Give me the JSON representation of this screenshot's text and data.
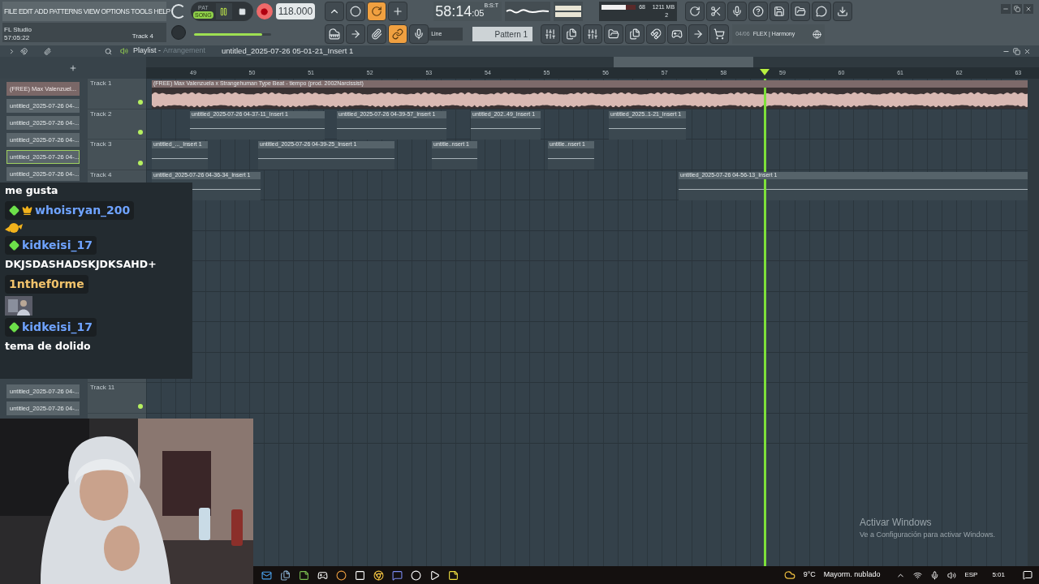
{
  "menu": [
    "FILE",
    "EDIT",
    "ADD",
    "PATTERNS",
    "VIEW",
    "OPTIONS",
    "TOOLS",
    "HELP"
  ],
  "hint_panel": {
    "title": "FL Studio",
    "time": "57:05:22",
    "track": "Track 4"
  },
  "transport": {
    "modes": [
      {
        "label": "PAT",
        "selected": false
      },
      {
        "label": "SONG",
        "selected": true
      }
    ],
    "playing": true,
    "recording": true,
    "tempo": "118.000"
  },
  "clock": {
    "time": "58:14",
    "sub": ":05",
    "unit": "B:S:T"
  },
  "cpu": {
    "level": 0.72,
    "polyphony": "68",
    "memory": "1211 MB",
    "count": "2"
  },
  "master_volume": {
    "level": 0.88
  },
  "snap": {
    "value": "Line"
  },
  "pattern": {
    "value": "Pattern 1"
  },
  "news": {
    "page": "04/06",
    "text": "FLEX | Harmony"
  },
  "playlist": {
    "title": "Playlist -",
    "subtitle": "Arrangement",
    "source": "untitled_2025-07-26 05-01-21_Insert 1",
    "bars": [
      "49",
      "50",
      "51",
      "52",
      "53",
      "54",
      "55",
      "56",
      "57",
      "58",
      "59",
      "60",
      "61",
      "62",
      "63"
    ]
  },
  "picker": {
    "top": [
      {
        "label": "(FREE) Max Valenzuel...",
        "kind": "audio",
        "selected": false
      },
      {
        "label": "untitled_2025-07-26 04-...",
        "kind": "pattern",
        "selected": false
      },
      {
        "label": "untitled_2025-07-26 04-...",
        "kind": "pattern",
        "selected": false
      },
      {
        "label": "untitled_2025-07-26 04-...",
        "kind": "pattern",
        "selected": false
      },
      {
        "label": "untitled_2025-07-26 04-...",
        "kind": "pattern",
        "selected": true
      },
      {
        "label": "untitled_2025-07-26 04-...",
        "kind": "pattern",
        "selected": false
      }
    ],
    "bottom": [
      {
        "label": "untitled_2025-07-26 04-...",
        "selected": false
      },
      {
        "label": "untitled_2025-07-26 04-...",
        "selected": false
      }
    ]
  },
  "tracks": [
    {
      "name": "Track 1",
      "on": true,
      "clips": [
        {
          "label": "(FREE) Max Valenzuela x Strangehuman Type Beat - tiempo (prod. 2002Narcissist)",
          "kind": "audio"
        }
      ]
    },
    {
      "name": "Track 2",
      "on": true,
      "clips": [
        {
          "label": "untitled_2025-07-26 04-37-11_Insert 1",
          "kind": "pattern"
        },
        {
          "label": "untitled_2025-07-26 04-39-57_Insert 1",
          "kind": "pattern"
        },
        {
          "label": "untitled_202..49_Insert 1",
          "kind": "pattern"
        },
        {
          "label": "untitled_2025..1-21_Insert 1",
          "kind": "pattern"
        }
      ]
    },
    {
      "name": "Track 3",
      "on": true,
      "clips": [
        {
          "label": "untitled_..._Insert 1",
          "kind": "pattern"
        },
        {
          "label": "untitled_2025-07-26 04-39-25_Insert 1",
          "kind": "pattern"
        },
        {
          "label": "untitle..nsert 1",
          "kind": "pattern"
        },
        {
          "label": "untitle..nsert 1",
          "kind": "pattern"
        }
      ]
    },
    {
      "name": "Track 4",
      "clips": [
        {
          "label": "untitled_2025-07-26 04-36-34_Insert 1",
          "kind": "pattern"
        },
        {
          "label": "untitled_2025-07-26 04-56-13_Insert 1",
          "kind": "pattern"
        }
      ]
    },
    {
      "name": "Track 11",
      "on": true
    }
  ],
  "chat": [
    {
      "kind": "text",
      "text": "me gusta"
    },
    {
      "kind": "emote",
      "user": "whoisryan_200",
      "color": "#6fa3ff",
      "subscriber": true,
      "crown": true
    },
    {
      "kind": "text",
      "user": "kidkeisi_17",
      "color": "#6fa3ff",
      "subscriber": true,
      "crown": false,
      "text": "DKJSDASHADSKJDKSAHD+"
    },
    {
      "user": "1nthef0rme",
      "color": "#f2c36b",
      "subscriber": false,
      "crown": false
    },
    {
      "kind": "text",
      "user": "kidkeisi_17",
      "color": "#6fa3ff",
      "subscriber": true,
      "crown": false,
      "text": "tema de dolido"
    }
  ],
  "activation": {
    "title": "Activar Windows",
    "text": "Ve a Configuración para activar Windows."
  },
  "taskbar": {
    "temperature": "9°C",
    "forecast": "Mayorm. nublado",
    "language": "ESP",
    "time": "5:01"
  }
}
